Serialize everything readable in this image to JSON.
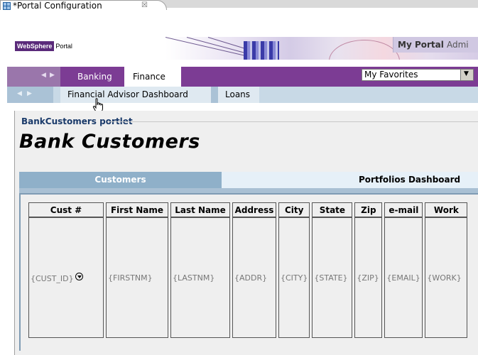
{
  "editor": {
    "tab_title": "*Portal Configuration",
    "tab_close": "☒"
  },
  "banner": {
    "logo_brand": "WebSphere",
    "logo_product": "Portal",
    "my_portal": "My Portal",
    "admin": "Admi"
  },
  "topnav": {
    "prev_arrow": "◀",
    "next_arrow": "▶",
    "tabs": [
      {
        "label": "Banking"
      },
      {
        "label": "Finance"
      }
    ],
    "favorites_select": "My Favorites",
    "favorites_arrow": "▼"
  },
  "subnav": {
    "prev_arrow": "◀",
    "next_arrow": "▶",
    "tabs": [
      {
        "label": "Financial Advisor Dashboard"
      },
      {
        "label": "Loans"
      }
    ]
  },
  "portlet": {
    "title": "BankCustomers portlet",
    "heading": "Bank Customers",
    "tabs": [
      {
        "label": "Customers"
      },
      {
        "label": "Portfolios Dashboard"
      }
    ]
  },
  "table": {
    "headers": [
      "Cust #",
      "First Name",
      "Last Name",
      "Address",
      "City",
      "State",
      "Zip",
      "e-mail",
      "Work"
    ],
    "cells": [
      "{CUST_ID}",
      "{FIRSTNM}",
      "{LASTNM}",
      "{ADDR}",
      "{CITY}",
      "{STATE}",
      "{ZIP}",
      "{EMAIL}",
      "{WORK}"
    ]
  },
  "colors": {
    "nav_purple": "#7c3c94",
    "subnav_blue": "#c8d9e6",
    "portlet_title": "#1a3a6a",
    "tab_active": "#8fb0c9"
  },
  "icons": [
    "portal-config-icon",
    "close-icon",
    "chevron-left-icon",
    "chevron-right-icon",
    "dropdown-arrow-icon",
    "hand-cursor-icon",
    "dropdown-circle-icon"
  ]
}
